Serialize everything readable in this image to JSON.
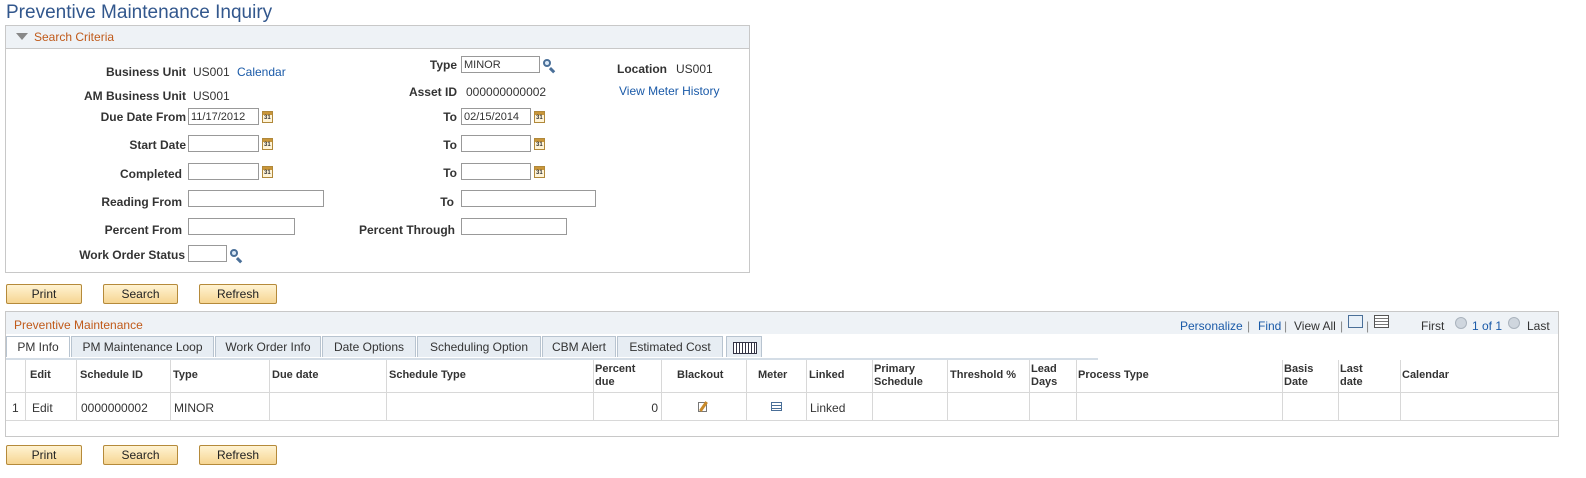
{
  "page": {
    "title": "Preventive Maintenance Inquiry"
  },
  "search": {
    "header": "Search Criteria",
    "business_unit_label": "Business Unit",
    "business_unit": "US001",
    "calendar_link": "Calendar",
    "type_label": "Type",
    "type_value": "MINOR",
    "location_label": "Location",
    "location": "US001",
    "am_bu_label": "AM Business Unit",
    "am_bu": "US001",
    "asset_id_label": "Asset ID",
    "asset_id": "000000000002",
    "meter_history_link": "View Meter History",
    "due_from_label": "Due Date From",
    "due_from": "11/17/2012",
    "to_label": "To",
    "due_to": "02/15/2014",
    "start_label": "Start Date",
    "start_from": "",
    "start_to": "",
    "completed_label": "Completed",
    "completed_from": "",
    "completed_to": "",
    "reading_label": "Reading From",
    "reading_from": "",
    "reading_to": "",
    "percent_from_label": "Percent From",
    "percent_from": "",
    "percent_through_label": "Percent Through",
    "percent_through": "",
    "wo_status_label": "Work Order Status",
    "wo_status": ""
  },
  "buttons": {
    "print": "Print",
    "search": "Search",
    "refresh": "Refresh"
  },
  "grid": {
    "title": "Preventive Maintenance",
    "personalize": "Personalize",
    "find": "Find",
    "view_all": "View All",
    "first": "First",
    "range": "1 of 1",
    "last": "Last",
    "tabs": [
      "PM Info",
      "PM Maintenance Loop",
      "Work Order Info",
      "Date Options",
      "Scheduling Option",
      "CBM Alert",
      "Estimated Cost"
    ],
    "columns": {
      "edit": "Edit",
      "schedule_id": "Schedule ID",
      "type": "Type",
      "due_date": "Due date",
      "schedule_type": "Schedule Type",
      "percent_due_1": "Percent",
      "percent_due_2": "due",
      "blackout": "Blackout",
      "meter": "Meter",
      "linked": "Linked",
      "primary_1": "Primary",
      "primary_2": "Schedule",
      "threshold": "Threshold %",
      "lead_1": "Lead",
      "lead_2": "Days",
      "process_type": "Process Type",
      "basis_1": "Basis",
      "basis_2": "Date",
      "last_1": "Last",
      "last_2": "date",
      "calendar": "Calendar"
    },
    "rows": [
      {
        "num": "1",
        "edit": "Edit",
        "schedule_id": "0000000002",
        "type": "MINOR",
        "due_date": "",
        "schedule_type": "",
        "percent_due": "0",
        "blackout_icon": "edit-check-icon",
        "meter_icon": "meter-list-icon",
        "linked": "Linked"
      }
    ]
  }
}
